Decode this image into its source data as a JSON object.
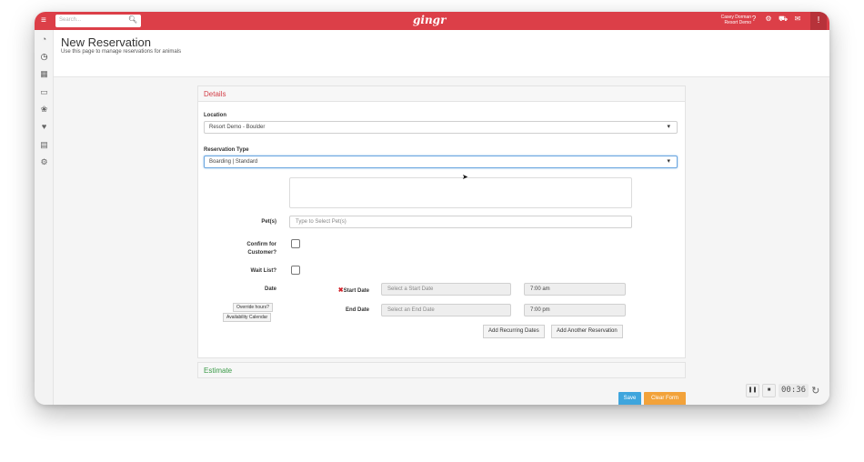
{
  "topbar": {
    "menu_icon": "hamburger-icon",
    "search_placeholder": "Search...",
    "logo": "gingr",
    "user_name": "Casey Dorman",
    "user_org": "Resort Demo",
    "icons": [
      "help-icon",
      "settings-icon",
      "cart-icon",
      "chat-icon"
    ],
    "accent": "#dc3f48"
  },
  "sidebar": {
    "items": [
      "dashboard-icon",
      "clock-icon",
      "calendar-icon",
      "card-icon",
      "paw-icon",
      "heart-icon",
      "book-icon",
      "gears-icon"
    ]
  },
  "page": {
    "title": "New Reservation",
    "subtitle": "Use this page to manage reservations for animals"
  },
  "details": {
    "heading": "Details",
    "location_label": "Location",
    "location_value": "Resort Demo - Boulder",
    "type_label": "Reservation Type",
    "type_value": "Boarding | Standard",
    "pets_label": "Pet(s)",
    "pets_placeholder": "Type to Select Pet(s)",
    "confirm_label_1": "Confirm for",
    "confirm_label_2": "Customer?",
    "waitlist_label": "Wait List?",
    "date_label": "Date",
    "override_btn": "Override hours?",
    "availability_btn": "Availability Calendar",
    "start_label": "Start Date",
    "start_placeholder": "Select a Start Date",
    "start_time": "7:00 am",
    "end_label": "End Date",
    "end_placeholder": "Select an End Date",
    "end_time": "7:00 pm",
    "recurring_btn": "Add Recurring Dates",
    "another_btn": "Add Another Reservation"
  },
  "estimate": {
    "heading": "Estimate"
  },
  "actions": {
    "save": "Save",
    "clear": "Clear Form"
  },
  "timer": {
    "pause_icon": "pause-icon",
    "stop_icon": "stop-icon",
    "time": "00:36",
    "refresh_icon": "refresh-icon"
  }
}
